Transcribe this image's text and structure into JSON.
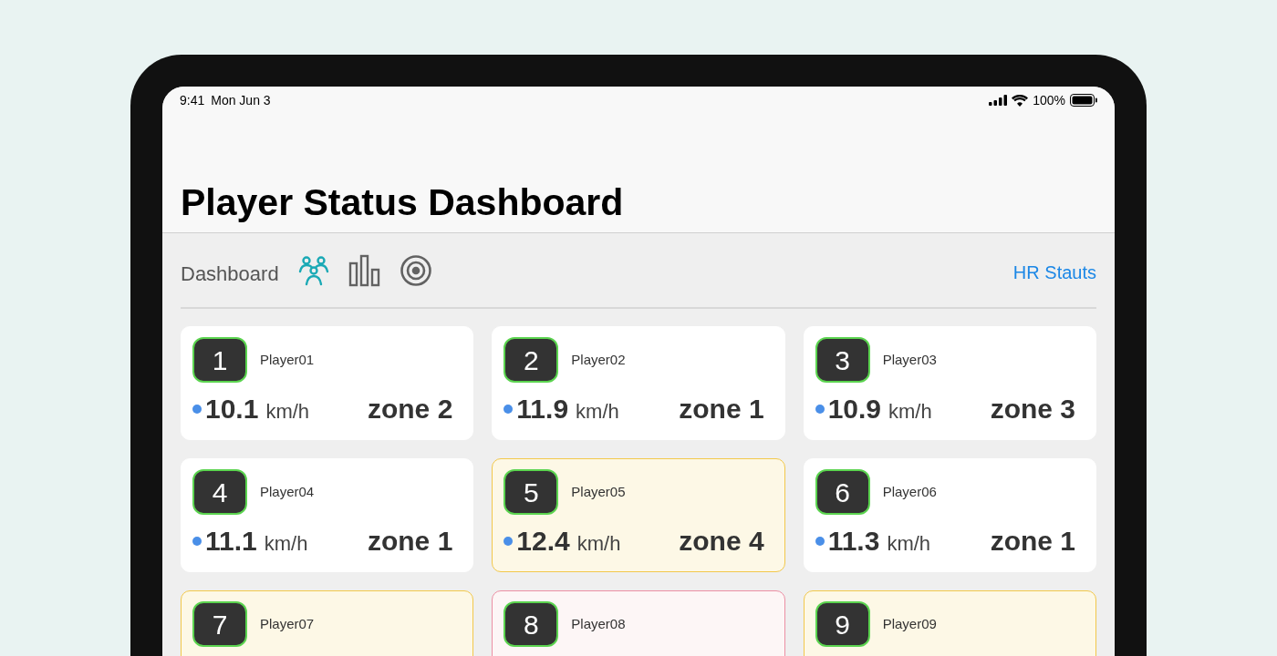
{
  "status_bar": {
    "time": "9:41",
    "date": "Mon Jun 3",
    "battery": "100%"
  },
  "title": "Player Status Dashboard",
  "toolbar": {
    "label": "Dashboard",
    "tabs": [
      {
        "kind": "people",
        "selected": true
      },
      {
        "kind": "bars",
        "selected": false
      },
      {
        "kind": "target",
        "selected": false
      }
    ],
    "link": "HR Stauts"
  },
  "players": [
    {
      "number": "1",
      "name": "Player01",
      "kind": "normal",
      "speed": "10.1",
      "unit": "km/h",
      "zone": "zone 2"
    },
    {
      "number": "2",
      "name": "Player02",
      "kind": "normal",
      "speed": "11.9",
      "unit": "km/h",
      "zone": "zone 1"
    },
    {
      "number": "3",
      "name": "Player03",
      "kind": "normal",
      "speed": "10.9",
      "unit": "km/h",
      "zone": "zone 3"
    },
    {
      "number": "4",
      "name": "Player04",
      "kind": "normal",
      "speed": "11.1",
      "unit": "km/h",
      "zone": "zone 1"
    },
    {
      "number": "5",
      "name": "Player05",
      "kind": "warning",
      "speed": "12.4",
      "unit": "km/h",
      "zone": "zone 4"
    },
    {
      "number": "6",
      "name": "Player06",
      "kind": "normal",
      "speed": "11.3",
      "unit": "km/h",
      "zone": "zone 1"
    },
    {
      "number": "7",
      "name": "Player07",
      "kind": "warning"
    },
    {
      "number": "8",
      "name": "Player08",
      "kind": "alert"
    },
    {
      "number": "9",
      "name": "Player09",
      "kind": "warning"
    }
  ]
}
